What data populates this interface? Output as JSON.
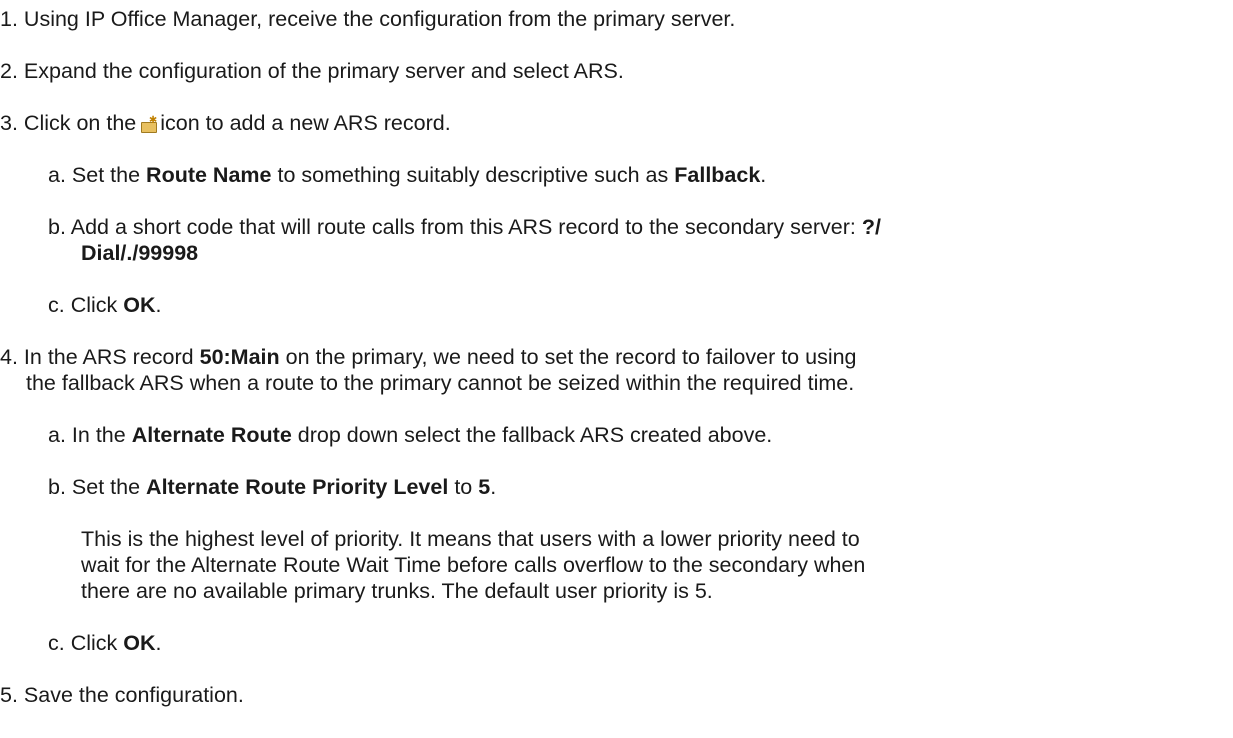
{
  "steps": {
    "s1": {
      "marker": "1.",
      "text": "Using IP Office Manager, receive the configuration from the primary server."
    },
    "s2": {
      "marker": "2.",
      "text": "Expand the configuration of the primary server and select ARS."
    },
    "s3": {
      "marker": "3.",
      "before_icon": "Click on the",
      "icon": "add-record-icon",
      "after_icon": "icon to add a new ARS record.",
      "a": {
        "marker": "a.",
        "t1": "Set the",
        "b1": "Route Name",
        "t2": "to something suitably descriptive such as",
        "b2": "Fallback",
        "t3": "."
      },
      "b": {
        "marker": "b.",
        "t1": "Add a short code that will route calls from this ARS record to the secondary server:",
        "b1": "?/",
        "b2": "Dial/./99998"
      },
      "c": {
        "marker": "c.",
        "t1": "Click",
        "b1": "OK",
        "t2": "."
      }
    },
    "s4": {
      "marker": "4.",
      "text_line1": "In the ARS record",
      "bold": "50:Main",
      "text_line1b": "on the primary, we need to set the record to failover to using",
      "text_line2": "the fallback ARS when a route to the primary cannot be seized within the required time.",
      "a": {
        "marker": "a.",
        "t1": "In the",
        "b1": "Alternate Route",
        "t2": "drop down select the fallback ARS created above."
      },
      "b": {
        "marker": "b.",
        "t1": "Set the",
        "b1": "Alternate Route Priority Level",
        "t2": "to",
        "b2": "5",
        "t3": ".",
        "note_line1": "This is the highest level of priority. It means that users with a lower priority need to",
        "note_line2": "wait for the Alternate Route Wait Time before calls overflow to the secondary when",
        "note_line3": "there are no available primary trunks. The default user priority is 5."
      },
      "c": {
        "marker": "c.",
        "t1": "Click",
        "b1": "OK",
        "t2": "."
      }
    },
    "s5": {
      "marker": "5.",
      "text": "Save the configuration."
    }
  }
}
